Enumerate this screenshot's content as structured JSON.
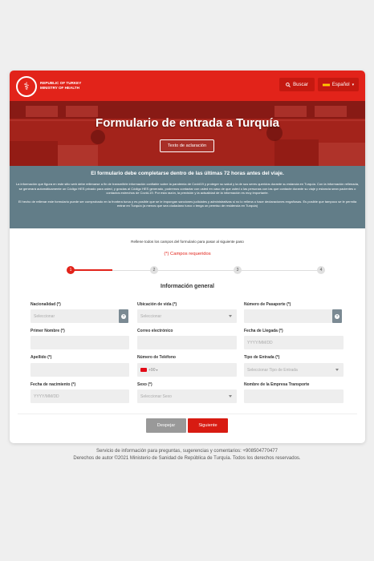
{
  "header": {
    "org_line1": "REPUBLIC OF TURKEY",
    "org_line2": "MINISTRY OF HEALTH",
    "search_label": "Buscar",
    "language_label": "Español",
    "brand_color": "#e2231a"
  },
  "hero": {
    "title": "Formulario de entrada a Turquía",
    "clarification_button": "Texto de aclaración"
  },
  "info": {
    "title": "El formulario debe completarse dentro de las últimas 72 horas antes del viaje.",
    "paragraph1": "La información que figura en este sitio web debe rellenarse a fin de transmitirle información confiable sobre la pandemia de Covid19 y proteger su salud y la de sus seres queridos durante su estancia en Turquía. Con la información rellenada, se generará automáticamente un Código HES privado para usted, y gracias al Código HES generado, podremos contactar con usted en caso de que usted o las personas con las que contacte durante su viaje y estancia sean pacientes o contactos estrechos de Covid-19. Por esta razón, la precisión y la actualidad de la información es muy importante.",
    "paragraph2": "El hecho de rellenar este formulario puede ser comprobado en la frontera turca y es posible que se le impongan sanciones judiciales y administrativas si no lo rellena o hace declaraciones engañosas. Es posible que tampoco se le permita entrar en Turquía (a menos que sea ciudadano turco o tenga un permiso de residencia en Turquía)"
  },
  "form": {
    "instructions": "Rellene todos los campos del formulario para pasar al siguiente paso",
    "required_note": "(*) Campos requeridos",
    "steps": [
      "1",
      "2",
      "3",
      "4"
    ],
    "active_step": 1,
    "section_title": "Información general",
    "fields": {
      "nationality": {
        "label": "Nacionalidad (*)",
        "placeholder": "Seleccionar"
      },
      "residence": {
        "label": "Ubicación de vida (*)",
        "placeholder": "Seleccionar"
      },
      "passport": {
        "label": "Número de Pasaporte (*)",
        "placeholder": ""
      },
      "first_name": {
        "label": "Primer Nombre (*)",
        "placeholder": ""
      },
      "email": {
        "label": "Correo electrónico",
        "placeholder": ""
      },
      "arrival_date": {
        "label": "Fecha de Llegada (*)",
        "placeholder": "YYYY/MM/DD"
      },
      "last_name": {
        "label": "Apellido (*)",
        "placeholder": ""
      },
      "phone": {
        "label": "Número de Teléfono",
        "prefix": "+90"
      },
      "entry_type": {
        "label": "Tipo de Entrada (*)",
        "placeholder": "Seleccionar Tipo de Entrada"
      },
      "birth_date": {
        "label": "Fecha de nacimiento (*)",
        "placeholder": "YYYY/MM/DD"
      },
      "sex": {
        "label": "Sexo (*)",
        "placeholder": "Seleccionar Sexo"
      },
      "transport_company": {
        "label": "Nombre de la Empresa Transporte",
        "placeholder": ""
      }
    },
    "clear_button": "Despejar",
    "next_button": "Siguiente"
  },
  "footer": {
    "line1": "Servicio de información para preguntas, sugerencias y comentarios: +908504770477",
    "line2": "Derechos de autor ©2021 Ministerio de Sanidad de República de Turquía. Todos los derechos reservados."
  }
}
